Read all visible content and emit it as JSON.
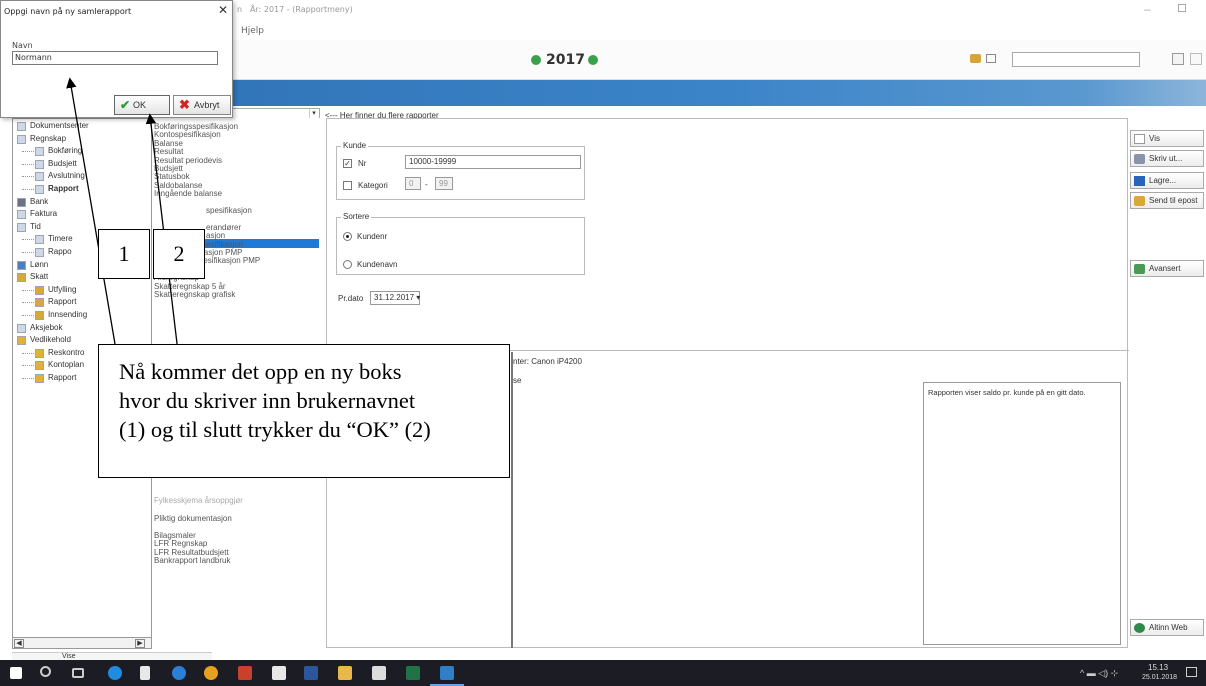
{
  "window": {
    "title": "År: 2017 - (Rapportmeny)",
    "title_prefix": "n",
    "menu_help": "Hjelp",
    "year": "2017"
  },
  "dialog": {
    "title": "Oppgi navn på ny samlerapport",
    "name_label": "Navn",
    "name_value": "Normann",
    "ok_label": "OK",
    "cancel_label": "Avbryt"
  },
  "hint": {
    "arrow": "<---",
    "text": "Her finner du flere rapporter"
  },
  "sidebar": {
    "items": [
      {
        "label": "Dokumentsenter",
        "bold": false
      },
      {
        "label": "Regnskap",
        "bold": false
      },
      {
        "label": "Bokføring",
        "bold": false
      },
      {
        "label": "Budsjett",
        "bold": false
      },
      {
        "label": "Avslutning",
        "bold": false
      },
      {
        "label": "Rapport",
        "bold": true
      },
      {
        "label": "Bank",
        "bold": false
      },
      {
        "label": "Faktura",
        "bold": false
      },
      {
        "label": "Tid",
        "bold": false
      },
      {
        "label": "Timere",
        "bold": false
      },
      {
        "label": "Rappo",
        "bold": false
      },
      {
        "label": "Lønn",
        "bold": false
      },
      {
        "label": "Skatt",
        "bold": false
      },
      {
        "label": "Utfylling",
        "bold": false
      },
      {
        "label": "Rapport",
        "bold": false
      },
      {
        "label": "Innsending",
        "bold": false
      },
      {
        "label": "Aksjebok",
        "bold": false
      },
      {
        "label": "Vedlikehold",
        "bold": false
      },
      {
        "label": "Reskontro",
        "bold": false
      },
      {
        "label": "Kontoplan",
        "bold": false
      },
      {
        "label": "Rapport",
        "bold": false
      }
    ],
    "bottom_tab": "Vise"
  },
  "reports": {
    "items": [
      "Bokføringsspesifikasjon",
      "Kontospesifikasjon",
      "Balanse",
      "Resultat",
      "Resultat periodevis",
      "Budsjett",
      "Statusbok",
      "Saldobalanse",
      "Inngående balanse",
      "",
      "spesifikasjon",
      "",
      "erandører",
      "asjon",
      "esifikasjon",
      "Kundespesifikasjon PMP",
      "Leverandørspesifikasjon PMP",
      "",
      "Årsregnskap",
      "Skatteregnskap 5 år",
      "Skatteregnskap grafisk"
    ],
    "items_lower": [
      "Pliktig dokumentasjon",
      "",
      "Bilagsmaler",
      "LFR Regnskap",
      "LFR Resultatbudsjett",
      "Bankrapport landbruk"
    ],
    "partial_item": "Fylkesskjema årsoppgjør"
  },
  "form": {
    "customer_group": "Kunde",
    "nr_label": "Nr",
    "nr_checked": true,
    "nr_value": "10000-19999",
    "category_label": "Kategori",
    "category_checked": false,
    "category_from": "0",
    "category_sep": "-",
    "category_to": "99",
    "sort_group": "Sortere",
    "sort_options": [
      "Kundenr",
      "Kundenavn"
    ],
    "sort_selected": 0,
    "date_label": "Pr.dato",
    "date_value": "31.12.2017"
  },
  "printer": {
    "text": "nter: Canon iP4200",
    "text2": "se"
  },
  "description": "Rapporten viser saldo pr. kunde på en gitt dato.",
  "right_buttons": {
    "show": "Vis",
    "print": "Skriv ut...",
    "save": "Lagre...",
    "email": "Send til epost",
    "advanced": "Avansert",
    "altinn": "Altinn Web"
  },
  "annotation": {
    "num1": "1",
    "num2": "2",
    "line1": "Nå kommer det opp en ny boks",
    "line2": "hvor du skriver inn brukernavnet",
    "line3": "(1) og til slutt trykker du “OK” (2)"
  },
  "clock": {
    "time": "15.13",
    "date": "25.01.2018"
  },
  "colors": {
    "accent_blue": "#2e6fb2",
    "selection": "#1e7ad6",
    "year_green": "#3aa04a"
  }
}
